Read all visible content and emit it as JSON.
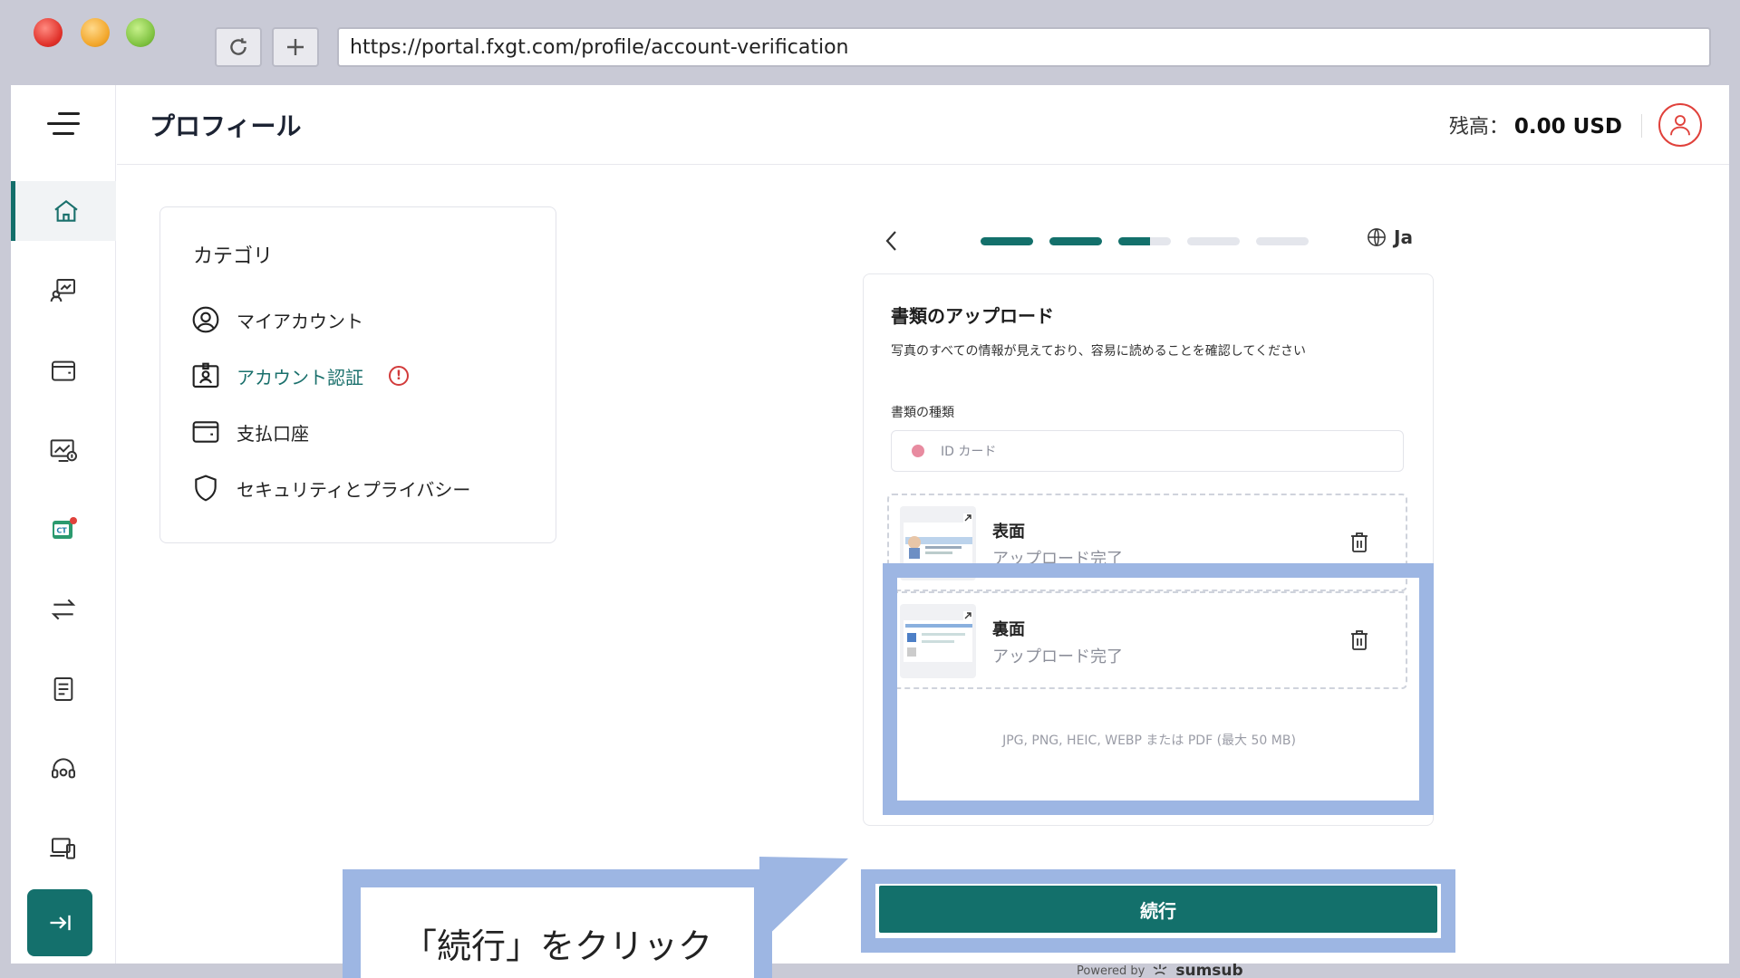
{
  "browser": {
    "url": "https://portal.fxgt.com/profile/account-verification",
    "reload_icon": "reload-icon",
    "newtab_icon": "plus-icon"
  },
  "header": {
    "title": "プロフィール",
    "balance_label": "残高：",
    "balance_amount": "0.00 USD"
  },
  "sidebar": {
    "items": [
      {
        "icon": "home-icon",
        "active": true
      },
      {
        "icon": "trading-icon",
        "active": false
      },
      {
        "icon": "wallet-icon",
        "active": false
      },
      {
        "icon": "chart-monitor-icon",
        "active": false
      },
      {
        "icon": "copytrade-icon",
        "active": false,
        "badge": true
      },
      {
        "icon": "transfer-icon",
        "active": false
      },
      {
        "icon": "document-icon",
        "active": false
      },
      {
        "icon": "support-icon",
        "active": false
      },
      {
        "icon": "devices-icon",
        "active": false
      }
    ],
    "collapse_icon": "collapse-icon"
  },
  "category": {
    "title": "カテゴリ",
    "items": [
      {
        "label": "マイアカウント",
        "icon": "user-circle-icon"
      },
      {
        "label": "アカウント認証",
        "icon": "id-card-icon",
        "active": true,
        "warning": "!"
      },
      {
        "label": "支払口座",
        "icon": "wallet-icon"
      },
      {
        "label": "セキュリティとプライバシー",
        "icon": "shield-icon"
      }
    ]
  },
  "verification": {
    "language": "Ja",
    "steps": [
      {
        "state": "done"
      },
      {
        "state": "done"
      },
      {
        "state": "partial",
        "progress": 0.6
      },
      {
        "state": "pending"
      },
      {
        "state": "pending"
      }
    ],
    "title": "書類のアップロード",
    "description": "写真のすべての情報が見えており、容易に読めることを確認してください",
    "doc_type_label": "書類の種類",
    "doc_type_value": "ID カード",
    "files": [
      {
        "name": "表面",
        "status": "アップロード完了"
      },
      {
        "name": "裏面",
        "status": "アップロード完了"
      }
    ],
    "formats": "JPG, PNG, HEIC, WEBP または PDF (最大 50 MB)",
    "continue_label": "続行",
    "powered_by": "Powered by",
    "brand": "sumsub"
  },
  "tutorial": {
    "callout_text": "「続行」をクリック",
    "highlight_color": "#9db6e3"
  },
  "colors": {
    "accent": "#13706b",
    "warning": "#d23b3b"
  }
}
